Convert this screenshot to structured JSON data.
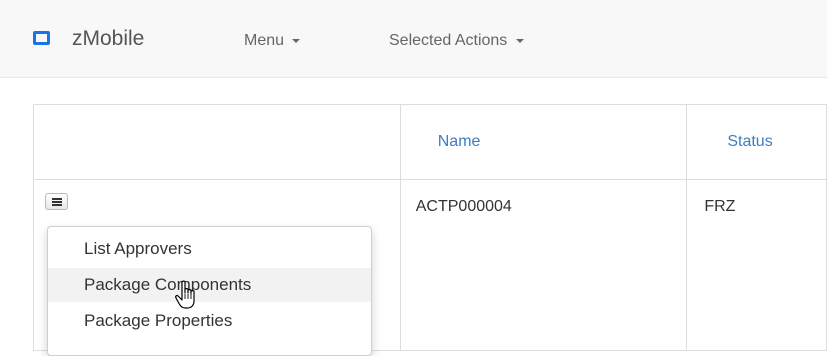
{
  "navbar": {
    "brand": "zMobile",
    "brand_icon": "square-logo-icon",
    "menu_label": "Menu",
    "selected_actions_label": "Selected Actions"
  },
  "table": {
    "columns": [
      "",
      "Name",
      "Status"
    ],
    "rows": [
      {
        "name": "ACTP000004",
        "status": "FRZ"
      }
    ]
  },
  "row_menu": {
    "button_icon": "hamburger-icon",
    "items": [
      {
        "label": "List Approvers"
      },
      {
        "label": "Package Components",
        "hovered": true
      },
      {
        "label": "Package Properties"
      }
    ]
  },
  "colors": {
    "accent": "#1a73e8",
    "link": "#3a7fc1",
    "navbar_bg": "#f8f8f8"
  }
}
